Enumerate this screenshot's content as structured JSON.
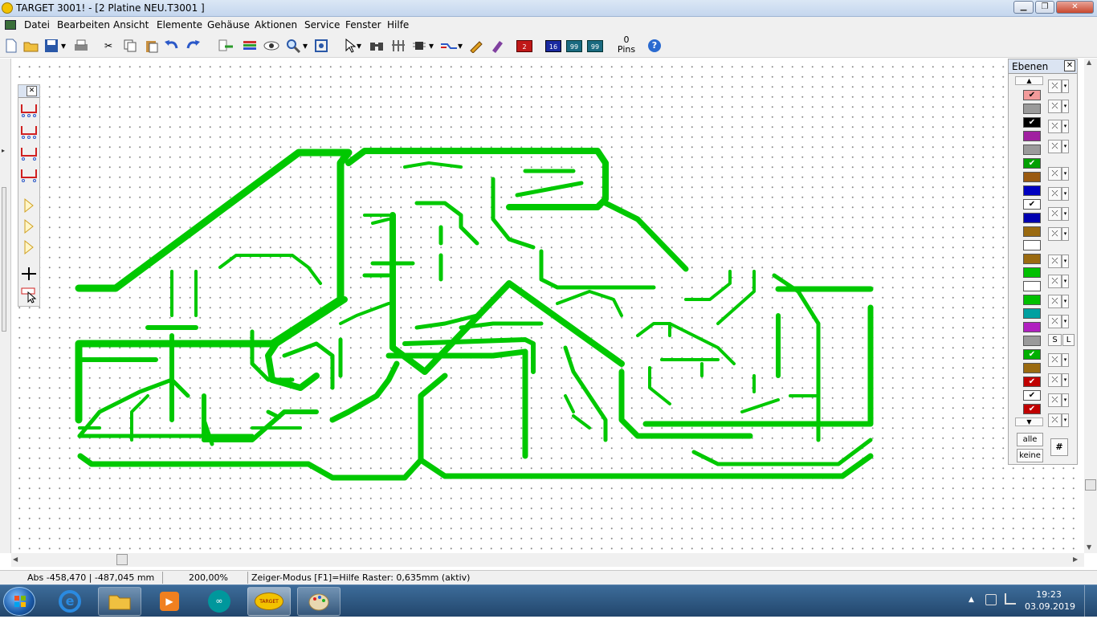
{
  "window": {
    "title": "TARGET 3001! - [2 Platine NEU.T3001 ]"
  },
  "menu": [
    "Datei",
    "Bearbeiten",
    "Ansicht",
    "Elemente",
    "Gehäuse",
    "Aktionen",
    "Service",
    "Fenster",
    "Hilfe"
  ],
  "toolbar": {
    "pins_count": "0",
    "pins_label": "Pins",
    "layer_a": "2",
    "layer_b": "16",
    "layer_c": "99",
    "layer_d": "99"
  },
  "layers_panel": {
    "title": "Ebenen",
    "all_label": "alle",
    "none_label": "keine",
    "s_label": "S",
    "l_label": "L",
    "grid_label": "#"
  },
  "status": {
    "coords": "Abs -458,470 | -487,045 mm",
    "zoom": "200,00%",
    "mode": "Zeiger-Modus  [F1]=Hilfe   Raster: 0,635mm (aktiv)"
  },
  "clock": {
    "time": "19:23",
    "date": "03.09.2019"
  },
  "layers": [
    {
      "color": "#f29a9a",
      "checked": true
    },
    {
      "color": "#9a9a9a",
      "checked": false
    },
    {
      "color": "#000000",
      "checked": true
    },
    {
      "color": "#a020a0",
      "checked": false
    },
    {
      "color": "#9a9a9a",
      "checked": false
    },
    {
      "color": "#00a000",
      "checked": true
    },
    {
      "color": "#9a5a10",
      "checked": false
    },
    {
      "color": "#0000c0",
      "checked": false
    },
    {
      "color": "#ffffff",
      "checked": true
    },
    {
      "color": "#0000b0",
      "checked": false
    },
    {
      "color": "#9a6a10",
      "checked": false
    },
    {
      "color": "#ffffff",
      "checked": false
    },
    {
      "color": "#9a6a10",
      "checked": false
    },
    {
      "color": "#00c000",
      "checked": false
    },
    {
      "color": "#ffffff",
      "checked": false
    },
    {
      "color": "#00c000",
      "checked": false
    },
    {
      "color": "#00a0a0",
      "checked": false
    },
    {
      "color": "#b020c0",
      "checked": false
    },
    {
      "color": "#9a9a9a",
      "checked": false
    },
    {
      "color": "#00b000",
      "checked": true
    },
    {
      "color": "#9a6a10",
      "checked": false
    },
    {
      "color": "#c00000",
      "checked": true
    },
    {
      "color": "#ffffff",
      "checked": true
    },
    {
      "color": "#c00000",
      "checked": true
    }
  ],
  "trace_color": "#00c800"
}
